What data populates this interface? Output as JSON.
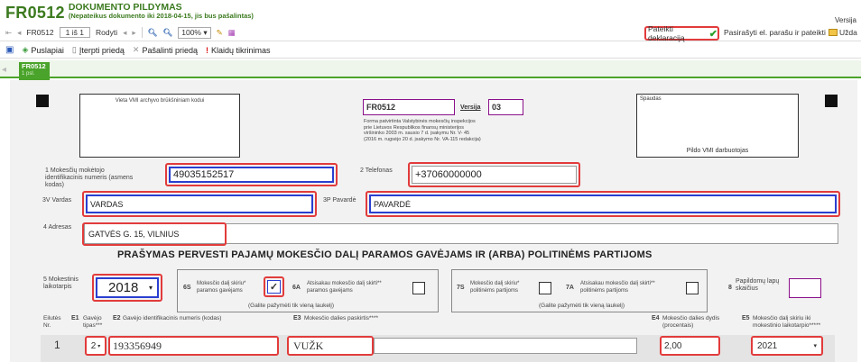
{
  "header": {
    "code": "FR0512",
    "title_line1": "DOKUMENTO PILDYMAS",
    "title_line2": "(Nepateikus dokumento iki 2018-04-15, jis bus pašalintas)",
    "version_label": "Versija"
  },
  "nav": {
    "doc": "FR0512",
    "page": "1 iš 1",
    "show": "Rodyti",
    "zoom": "100%",
    "submit": "Pateikti deklaraciją",
    "sign": "Pasirašyti el. parašu ir pateikti",
    "close": "Užda"
  },
  "toolbar": {
    "pages": "Puslapiai",
    "insert": "Įterpti priedą",
    "remove": "Pašalinti priedą",
    "errors": "Klaidų tikrinimas"
  },
  "tab": {
    "code": "FR0512",
    "sub": "1 psl."
  },
  "form": {
    "archive_label": "Vieta VMI archyvo brūkšniniam kodui",
    "form_code": "FR0512",
    "version_label": "Versija",
    "version": "03",
    "approval": [
      "Forma patvirtinta Valstybinės mokesčių inspekcijos",
      "prie Lietuvos Respublikos finansų ministerijos",
      "viršininko 2003 m. sausio 7 d. įsakymu Nr. V- 45",
      "(2016 m. rugsėjo 20 d. įsakymo Nr. VA-115 redakcija)"
    ],
    "stamp_label": "Spaudas",
    "vmi_fill": "Pildo VMI darbuotojas",
    "f1_label": "Mokesčių mokėtojo identifikacinis numeris (asmens kodas)",
    "f1_num": "1",
    "f1_value": "49035152517",
    "f2_label": "Telefonas",
    "f2_num": "2",
    "f2_value": "+37060000000",
    "f3v_label": "Vardas",
    "f3v_num": "3V",
    "f3v_value": "VARDAS",
    "f3p_label": "Pavardė",
    "f3p_num": "3P",
    "f3p_value": "PAVARDĖ",
    "f4_label": "Adresas",
    "f4_num": "4",
    "f4_value": "GATVĖS G. 15, VILNIUS",
    "section_title": "PRAŠYMAS PERVESTI PAJAMŲ MOKESČIO DALĮ PARAMOS GAVĖJAMS IR (ARBA) POLITINĖMS PARTIJOMS",
    "f5_num": "5",
    "f5_label": "Mokestinis laikotarpis",
    "f5_value": "2018",
    "f6s_num": "6S",
    "f6s_label": "Mokesčio dalį skiriu* paramos gavėjams",
    "f6a_num": "6A",
    "f6a_label": "Atsisakau mokesčio dalį skirti** paramos gavėjams",
    "f7s_num": "7S",
    "f7s_label": "Mokesčio dalį skiriu* politinėms partijoms",
    "f7a_num": "7A",
    "f7a_label": "Atsisakau mokesčio dalį skirti** politinėms partijoms",
    "only_one": "(Galite pažymėti tik vieną laukelį)",
    "f8_num": "8",
    "f8_label": "Papildomų lapų skaičius",
    "cols": {
      "row": "Eilutės Nr.",
      "e1": "E1",
      "e1_label": "Gavėjo tipas***",
      "e2": "E2",
      "e2_label": "Gavėjo identifikacinis numeris (kodas)",
      "e3": "E3",
      "e3_label": "Mokesčio dalies paskirtis****",
      "e4": "E4",
      "e4_label": "Mokesčio dalies dydis (procentais)",
      "e5": "E5",
      "e5_label": "Mokesčio dalį skiriu iki mokestinio laikotarpio*****"
    },
    "row1": {
      "nr": "1",
      "type": "2",
      "id": "193356949",
      "purpose": "VUŽK",
      "percent": "2,00",
      "until": "2021"
    }
  },
  "colors": {
    "title": "#3b7a1e",
    "accent_red": "#e23b3b",
    "accent_blue": "#2a3fd0",
    "accent_purple": "#8a0f8a",
    "tab_green": "#4aa32a"
  }
}
